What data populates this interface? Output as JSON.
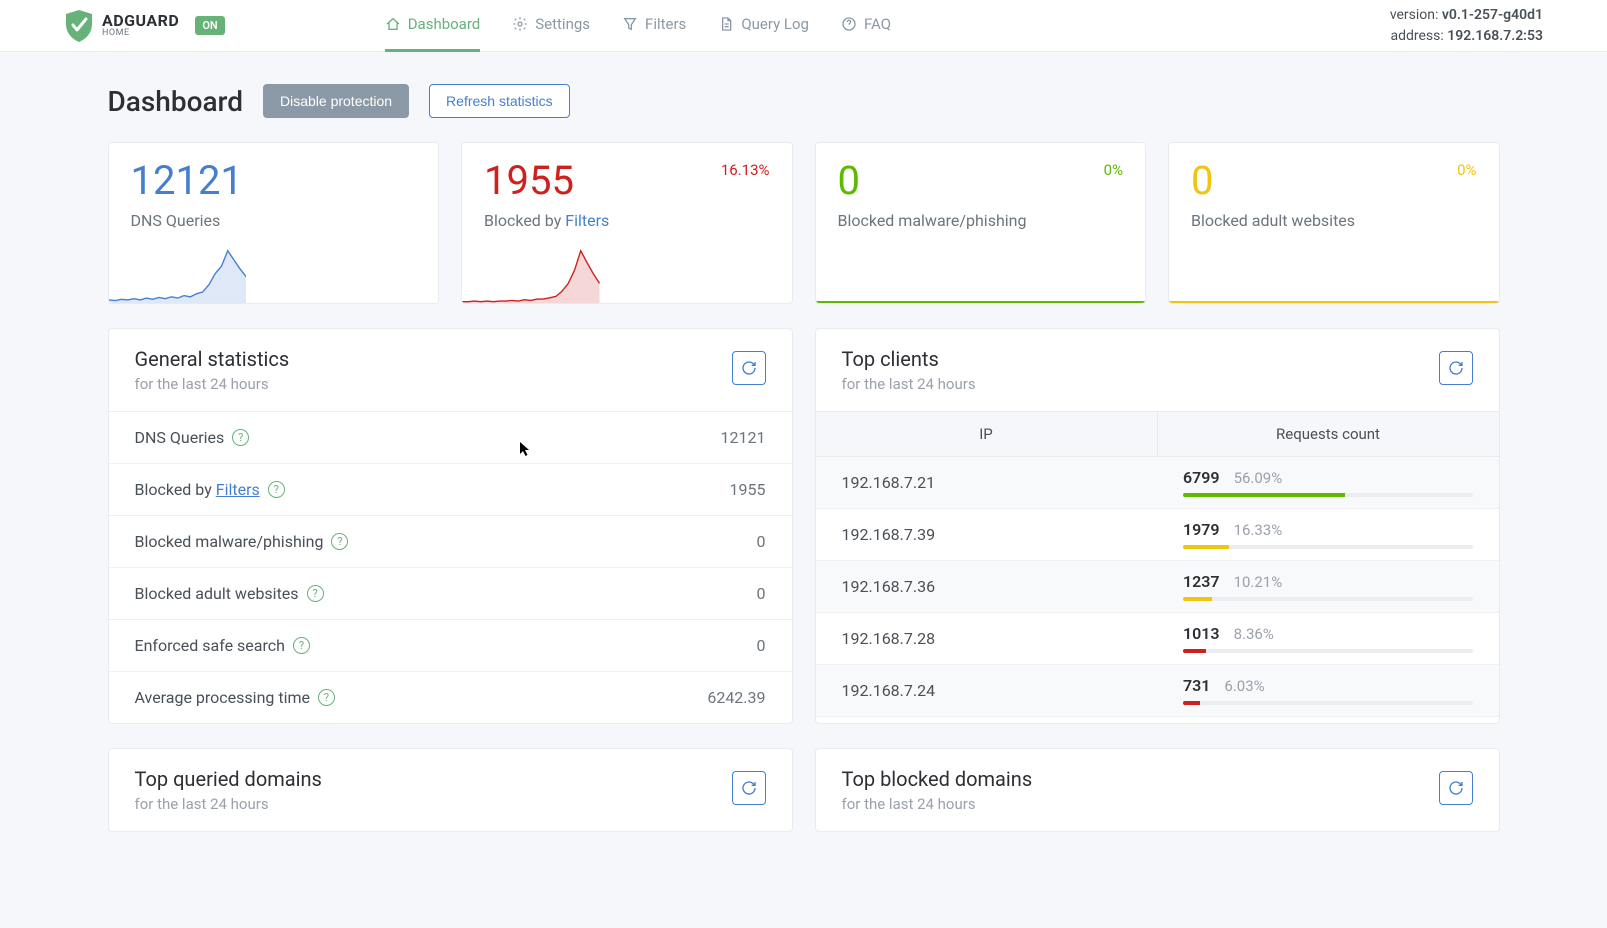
{
  "logo": {
    "name": "ADGUARD",
    "sub": "HOME",
    "status": "ON"
  },
  "nav": {
    "dashboard": "Dashboard",
    "settings": "Settings",
    "filters": "Filters",
    "querylog": "Query Log",
    "faq": "FAQ"
  },
  "meta": {
    "version_label": "version:",
    "version_value": "v0.1-257-g40d1",
    "address_label": "address:",
    "address_value": "192.168.7.2:53"
  },
  "page": {
    "title": "Dashboard",
    "disable_btn": "Disable protection",
    "refresh_btn": "Refresh statistics"
  },
  "cards": {
    "dns": {
      "value": "12121",
      "label": "DNS Queries",
      "color": "#467fcf"
    },
    "blocked": {
      "value": "1955",
      "label_pre": "Blocked by ",
      "label_link": "Filters",
      "pct": "16.13%",
      "color": "#cd201f"
    },
    "malware": {
      "value": "0",
      "label": "Blocked malware/phishing",
      "pct": "0%",
      "color": "#5eba00"
    },
    "adult": {
      "value": "0",
      "label": "Blocked adult websites",
      "pct": "0%",
      "color": "#f1c40f"
    }
  },
  "chart_data": [
    {
      "type": "area",
      "title": "DNS Queries sparkline",
      "values": [
        5,
        4,
        6,
        5,
        7,
        5,
        8,
        6,
        9,
        7,
        10,
        8,
        12,
        10,
        15,
        18,
        30,
        48,
        60,
        85,
        70,
        55,
        42
      ],
      "color": "#467fcf"
    },
    {
      "type": "area",
      "title": "Blocked by Filters sparkline",
      "values": [
        2,
        2,
        3,
        2,
        3,
        2,
        3,
        3,
        4,
        3,
        5,
        4,
        6,
        6,
        8,
        10,
        18,
        30,
        50,
        80,
        62,
        45,
        30
      ],
      "color": "#cd201f"
    }
  ],
  "general_stats": {
    "title": "General statistics",
    "sub": "for the last 24 hours",
    "rows": [
      {
        "label": "DNS Queries",
        "value": "12121"
      },
      {
        "label_pre": "Blocked by ",
        "label_link": "Filters",
        "value": "1955"
      },
      {
        "label": "Blocked malware/phishing",
        "value": "0"
      },
      {
        "label": "Blocked adult websites",
        "value": "0"
      },
      {
        "label": "Enforced safe search",
        "value": "0"
      },
      {
        "label": "Average processing time",
        "value": "6242.39"
      }
    ]
  },
  "top_clients": {
    "title": "Top clients",
    "sub": "for the last 24 hours",
    "col_ip": "IP",
    "col_req": "Requests count",
    "rows": [
      {
        "ip": "192.168.7.21",
        "count": "6799",
        "pct": "56.09%",
        "bar": 56,
        "color": "#5eba00"
      },
      {
        "ip": "192.168.7.39",
        "count": "1979",
        "pct": "16.33%",
        "bar": 16,
        "color": "#f1c40f"
      },
      {
        "ip": "192.168.7.36",
        "count": "1237",
        "pct": "10.21%",
        "bar": 10,
        "color": "#f1c40f"
      },
      {
        "ip": "192.168.7.28",
        "count": "1013",
        "pct": "8.36%",
        "bar": 8,
        "color": "#cd201f"
      },
      {
        "ip": "192.168.7.24",
        "count": "731",
        "pct": "6.03%",
        "bar": 6,
        "color": "#cd201f"
      }
    ]
  },
  "top_queried": {
    "title": "Top queried domains",
    "sub": "for the last 24 hours"
  },
  "top_blocked": {
    "title": "Top blocked domains",
    "sub": "for the last 24 hours"
  }
}
